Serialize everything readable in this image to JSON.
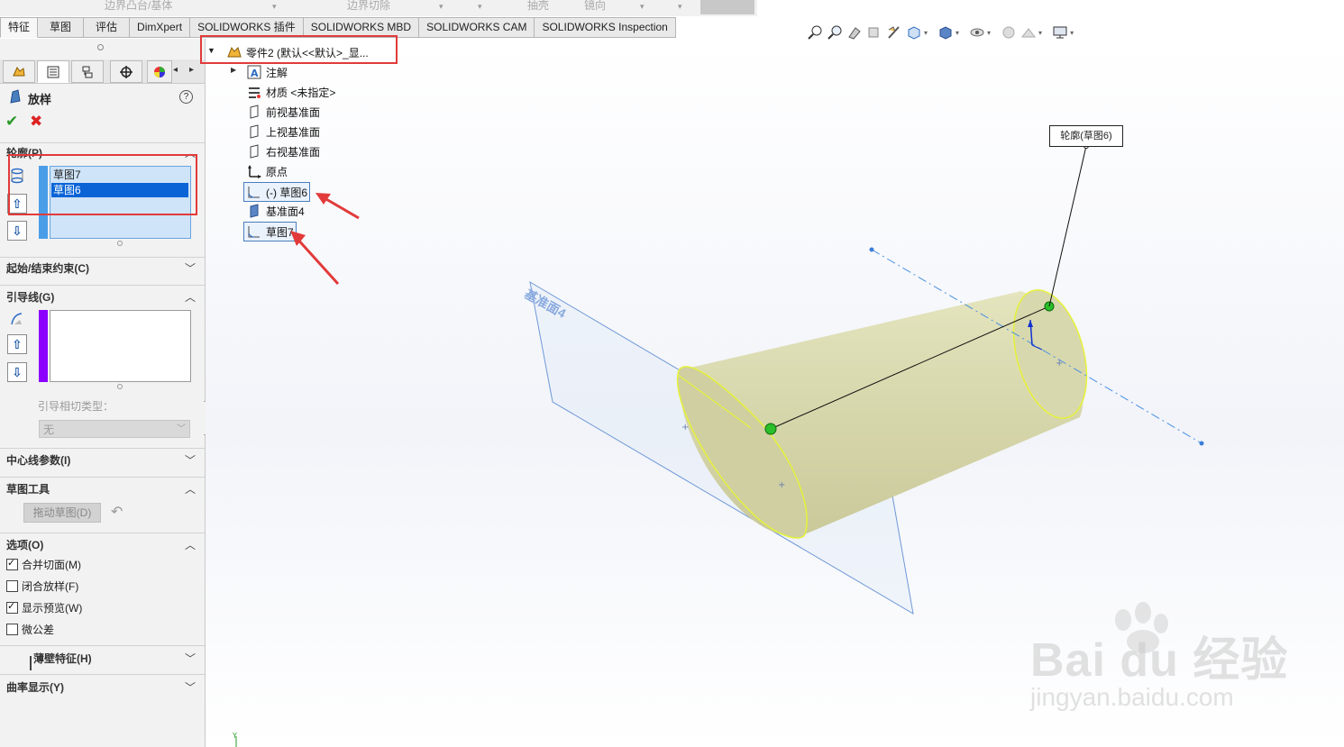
{
  "ribbon_top": {
    "items": [
      "边界凸台/基体",
      "边界切除",
      "抽壳",
      "镜向"
    ]
  },
  "tabs": [
    "特征",
    "草图",
    "评估",
    "DimXpert",
    "SOLIDWORKS 插件",
    "SOLIDWORKS MBD",
    "SOLIDWORKS CAM",
    "SOLIDWORKS Inspection"
  ],
  "property_manager": {
    "title": "放样",
    "profiles": {
      "header": "轮廓(P)",
      "items": [
        "草图7",
        "草图6"
      ],
      "selected_index": 1
    },
    "start_end_constraints": "起始/结束约束(C)",
    "guide_curves": {
      "header": "引导线(G)",
      "tangency_label": "引导相切类型：",
      "tangency_value": "无"
    },
    "centerline": "中心线参数(I)",
    "sketch_tools": {
      "header": "草图工具",
      "drag_button": "拖动草图(D)"
    },
    "options": {
      "header": "选项(O)",
      "items": [
        {
          "label": "合并切面(M)",
          "checked": true
        },
        {
          "label": "闭合放样(F)",
          "checked": false
        },
        {
          "label": "显示预览(W)",
          "checked": true
        },
        {
          "label": "微公差",
          "checked": false
        }
      ]
    },
    "thin_feature": "薄壁特征(H)",
    "curvature": "曲率显示(Y)"
  },
  "feature_tree": {
    "root": "零件2 (默认<<默认>_显...",
    "items": [
      {
        "label": "注解",
        "icon": "annotation-icon"
      },
      {
        "label": "材质 <未指定>",
        "icon": "material-icon"
      },
      {
        "label": "前视基准面",
        "icon": "plane-icon"
      },
      {
        "label": "上视基准面",
        "icon": "plane-icon"
      },
      {
        "label": "右视基准面",
        "icon": "plane-icon"
      },
      {
        "label": "原点",
        "icon": "origin-icon"
      },
      {
        "label": "(-) 草图6",
        "icon": "sketch-icon"
      },
      {
        "label": "基准面4",
        "icon": "plane-icon"
      },
      {
        "label": "草图7",
        "icon": "sketch-icon"
      }
    ]
  },
  "viewport": {
    "callout": "轮廓(草图6)",
    "plane_label": "基准面4"
  },
  "watermark": {
    "main": "Bai du 经验",
    "sub": "jingyan.baidu.com"
  },
  "colors": {
    "accent_red": "#e23a3a",
    "selection_blue": "#0a64d6",
    "body_fill": "#d6d6a8",
    "edge_yellow": "#e6f23a",
    "plane_blue": "#6f98d8"
  }
}
